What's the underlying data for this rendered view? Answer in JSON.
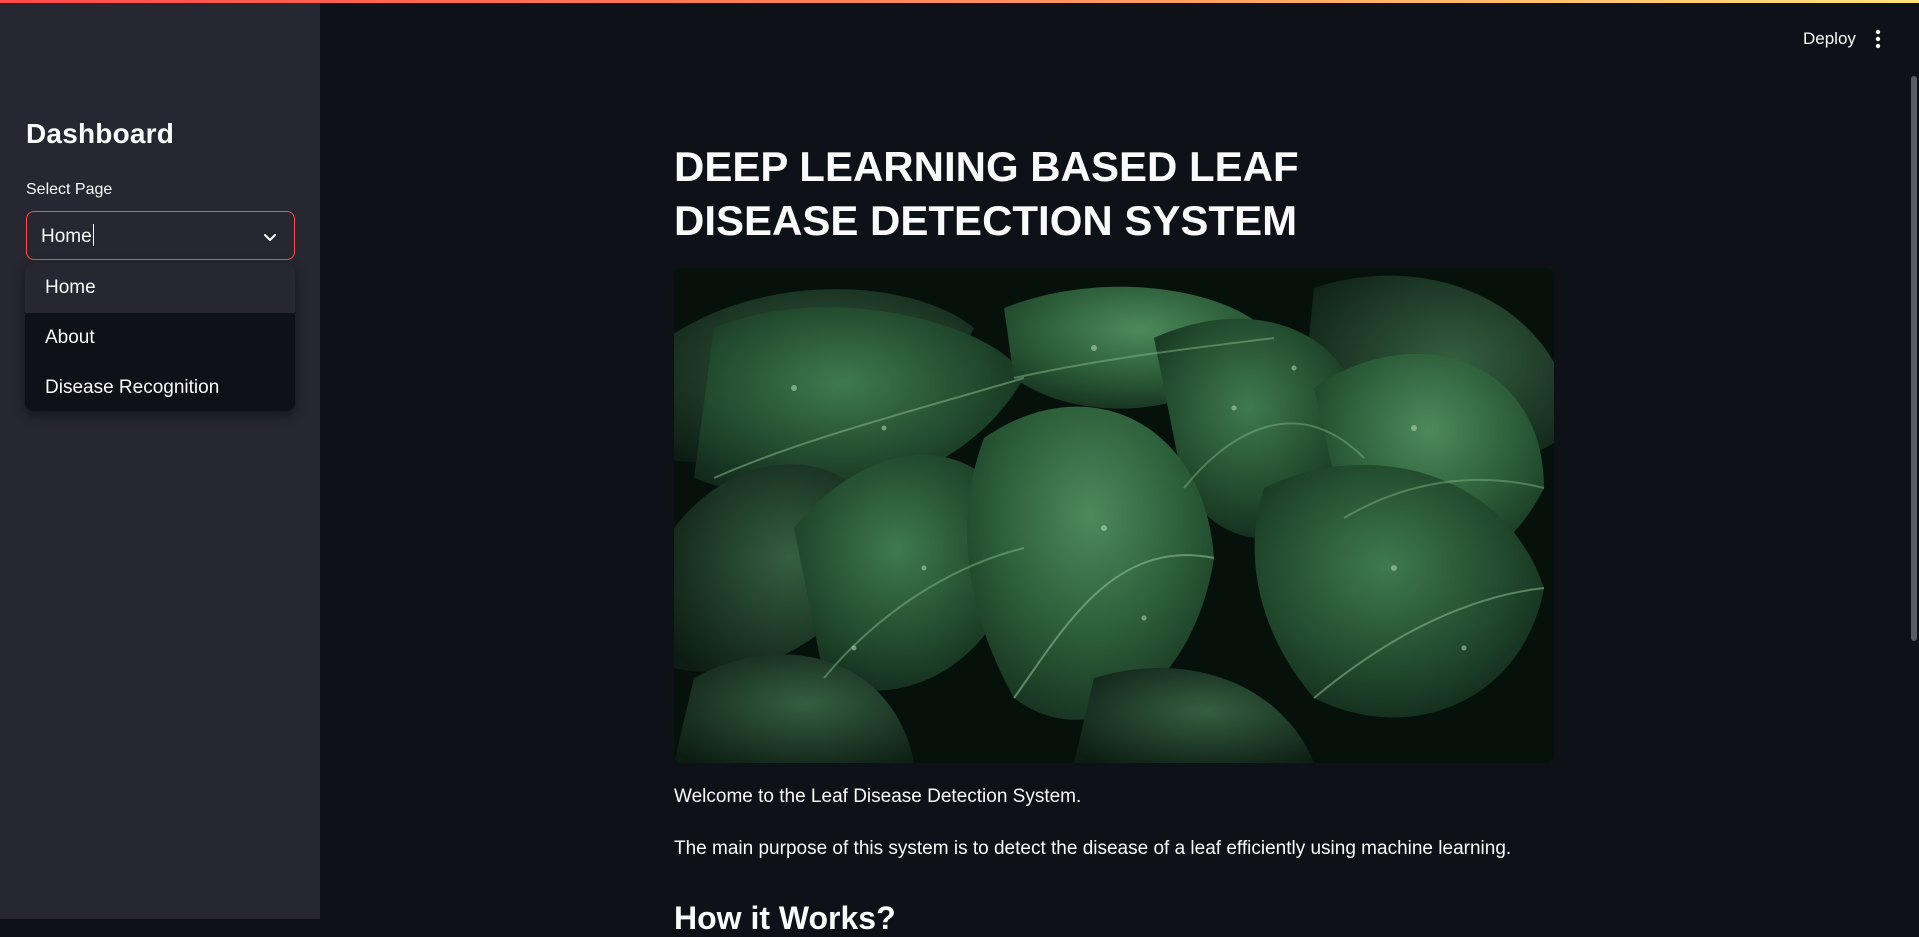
{
  "sidebar": {
    "title": "Dashboard",
    "select": {
      "label": "Select Page",
      "value": "Home",
      "options": [
        "Home",
        "About",
        "Disease Recognition"
      ]
    }
  },
  "header": {
    "deploy_label": "Deploy",
    "menu_icon": "more-vertical-icon"
  },
  "main": {
    "title": "DEEP LEARNING BASED LEAF DISEASE DETECTION SYSTEM",
    "welcome_text": "Welcome to the Leaf Disease Detection System.",
    "purpose_text": "The main purpose of this system is to detect the disease of a leaf efficiently using machine learning.",
    "section_heading": "How it Works?"
  },
  "colors": {
    "background": "#0e1117",
    "sidebar": "#262730",
    "accent": "#ff4b4b",
    "text": "#fafafa"
  }
}
